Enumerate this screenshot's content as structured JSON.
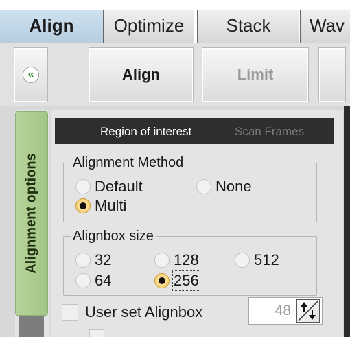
{
  "tabs": [
    {
      "label": "Align",
      "active": true
    },
    {
      "label": "Optimize",
      "active": false
    },
    {
      "label": "Stack",
      "active": false
    },
    {
      "label": "Wav",
      "active": false
    }
  ],
  "toolbar": {
    "collapse_icon": "«",
    "align_label": "Align",
    "limit_label": "Limit",
    "limit_enabled": false
  },
  "side_tab": {
    "label": "Alignment options"
  },
  "sub_tabs": {
    "region_of_interest": "Region of interest",
    "scan_frames": "Scan Frames"
  },
  "alignment_method": {
    "legend": "Alignment Method",
    "options": [
      {
        "label": "Default",
        "selected": false
      },
      {
        "label": "None",
        "selected": false
      },
      {
        "label": "Multi",
        "selected": true
      }
    ]
  },
  "alignbox_size": {
    "legend": "Alignbox size",
    "options": [
      {
        "label": "32",
        "selected": false
      },
      {
        "label": "128",
        "selected": false
      },
      {
        "label": "512",
        "selected": false
      },
      {
        "label": "64",
        "selected": false
      },
      {
        "label": "256",
        "selected": true
      }
    ]
  },
  "user_set_alignbox": {
    "label": "User set Alignbox",
    "checked": false,
    "value": "48",
    "icon": "spin-arrows-icon"
  },
  "colors": {
    "active_tab": "#c4d9e9",
    "side_tab": "#aecb8f",
    "selected_radio": "#f5c96a",
    "subheader": "#2e2e2e"
  }
}
